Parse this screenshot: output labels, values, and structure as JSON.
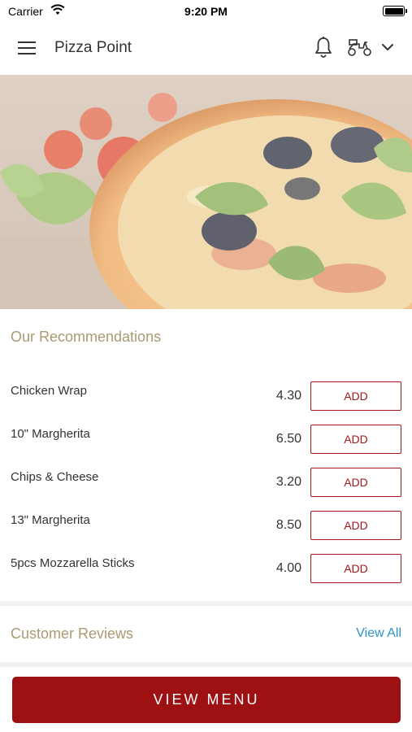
{
  "status_bar": {
    "carrier": "Carrier",
    "time": "9:20 PM"
  },
  "header": {
    "title": "Pizza Point"
  },
  "recommendations": {
    "title": "Our Recommendations",
    "items": [
      {
        "name": "Chicken Wrap",
        "price": "4.30",
        "button": "ADD"
      },
      {
        "name": "10\" Margherita",
        "price": "6.50",
        "button": "ADD"
      },
      {
        "name": "Chips & Cheese",
        "price": "3.20",
        "button": "ADD"
      },
      {
        "name": "13\" Margherita",
        "price": "8.50",
        "button": "ADD"
      },
      {
        "name": "5pcs Mozzarella Sticks",
        "price": "4.00",
        "button": "ADD"
      }
    ]
  },
  "reviews": {
    "title": "Customer Reviews",
    "view_all": "View All"
  },
  "footer": {
    "view_menu": "VIEW MENU"
  },
  "colors": {
    "accent": "#9d1112",
    "section_title": "#a89a73",
    "link": "#2a93c9"
  },
  "icons": [
    "wifi-icon",
    "battery-icon",
    "hamburger-menu-icon",
    "bell-icon",
    "delivery-scooter-icon",
    "chevron-down-icon"
  ]
}
